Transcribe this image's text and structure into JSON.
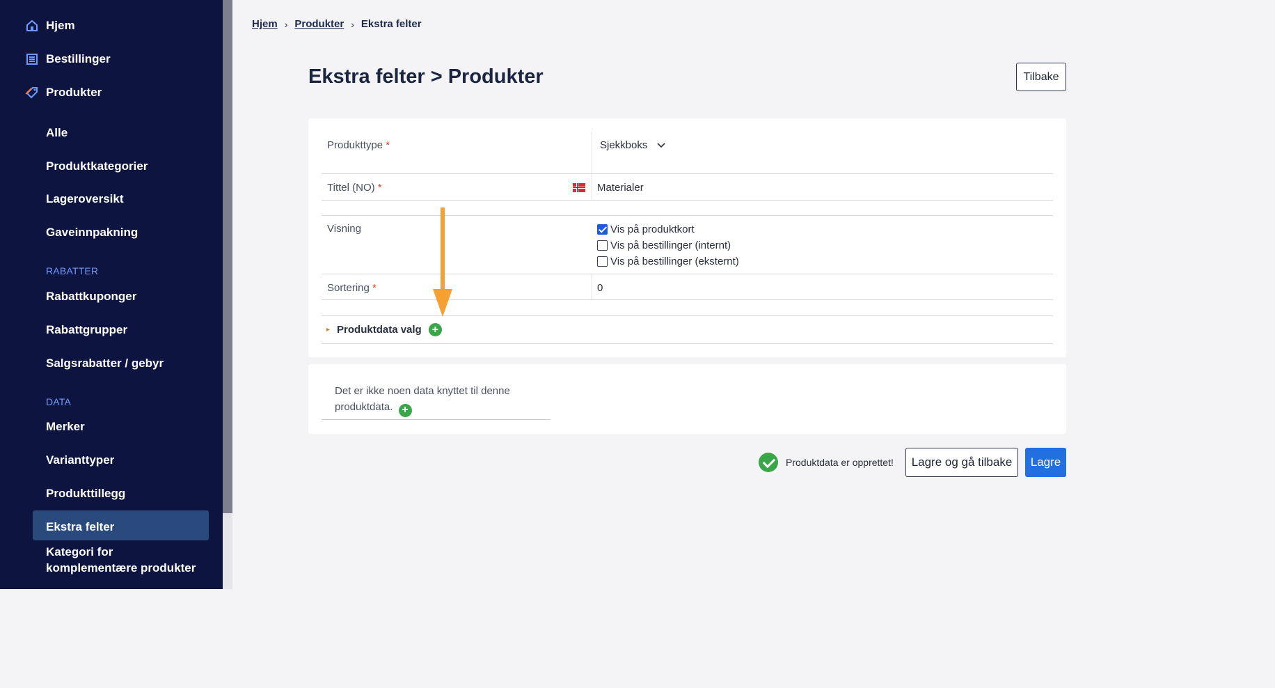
{
  "sidebar": {
    "top_items": [
      {
        "label": "Hjem",
        "icon": "home-icon"
      },
      {
        "label": "Bestillinger",
        "icon": "orders-icon"
      },
      {
        "label": "Produkter",
        "icon": "tag-icon"
      }
    ],
    "product_items": [
      "Alle",
      "Produktkategorier",
      "Lageroversikt",
      "Gaveinnpakning"
    ],
    "section_discounts": "RABATTER",
    "discount_items": [
      "Rabattkuponger",
      "Rabattgrupper",
      "Salgsrabatter / gebyr"
    ],
    "section_data": "DATA",
    "data_items": [
      "Merker",
      "Varianttyper",
      "Produkttillegg",
      "Ekstra felter"
    ],
    "last_item_line1": "Kategori for",
    "last_item_line2": "komplementære produkter",
    "active_item": "Ekstra felter"
  },
  "breadcrumb": {
    "items": [
      "Hjem",
      "Produkter"
    ],
    "current": "Ekstra felter"
  },
  "page": {
    "title": "Ekstra felter > Produkter",
    "back_label": "Tilbake"
  },
  "form": {
    "product_type_label": "Produkttype",
    "product_type_value": "Sjekkboks",
    "title_label": "Tittel (NO)",
    "title_value": "Materialer",
    "display_label": "Visning",
    "display_options": [
      {
        "label": "Vis på produktkort",
        "checked": true
      },
      {
        "label": "Vis på bestillinger (internt)",
        "checked": false
      },
      {
        "label": "Vis på bestillinger (eksternt)",
        "checked": false
      }
    ],
    "sort_label": "Sortering",
    "sort_value": "0",
    "required_mark": "*"
  },
  "options_section": {
    "title": "Produktdata valg"
  },
  "empty_state": {
    "text": "Det er ikke noen data knyttet til denne produktdata."
  },
  "footer": {
    "success_message": "Produktdata er opprettet!",
    "save_back_label": "Lagre og gå tilbake",
    "save_label": "Lagre"
  },
  "colors": {
    "sidebar_bg": "#0d1440",
    "active_bg": "#2a4a7d",
    "primary": "#2270e0",
    "success": "#3aa648",
    "annotation_arrow": "#f5a030"
  }
}
